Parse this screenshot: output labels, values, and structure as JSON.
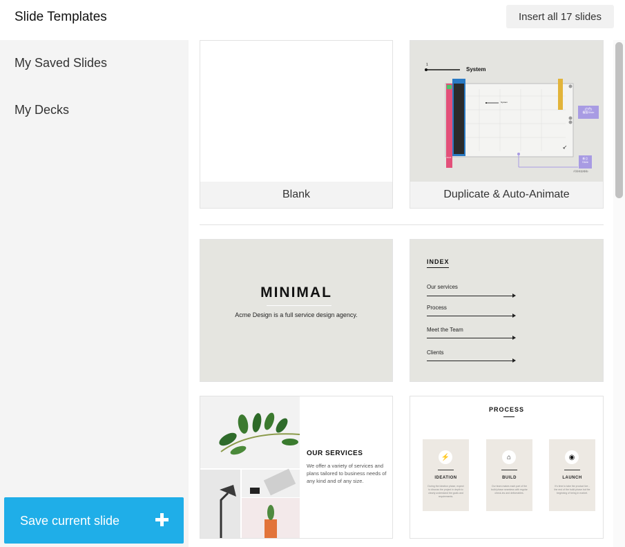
{
  "header": {
    "title": "Slide Templates",
    "insert_all_label": "Insert all 17 slides"
  },
  "sidebar": {
    "items": [
      {
        "label": "My Saved Slides"
      },
      {
        "label": "My Decks"
      }
    ],
    "save_label": "Save current slide",
    "save_icon": "plus-icon"
  },
  "templates": {
    "blank": {
      "caption": "Blank"
    },
    "duplicate": {
      "caption": "Duplicate & Auto-Animate",
      "system_label": "System",
      "small_system_label": "System",
      "badge1": "Dock",
      "badge_right1": "(白色)\n複製Slide",
      "badge_right2": "新立\nSlide",
      "note": "(可用/新加/移除)"
    },
    "minimal": {
      "title": "MINIMAL",
      "subtitle": "Acme Design is a full service design agency."
    },
    "index": {
      "title": "INDEX",
      "items": [
        "Our services",
        "Process",
        "Meet the Team",
        "Clients"
      ]
    },
    "services": {
      "title": "OUR SERVICES",
      "body": "We offer a variety of services and plans tailored to business needs of any kind and of any size."
    },
    "process": {
      "title": "PROCESS",
      "steps": [
        {
          "name": "IDEATION",
          "icon": "bolt-icon",
          "text": "During the ideation phase, expect to discuss the project in depth to clearly understand the goals and requirements."
        },
        {
          "name": "BUILD",
          "icon": "house-icon",
          "text": "Our team makes each part of the build phase seamless with regular check-ins and deliverables."
        },
        {
          "name": "LAUNCH",
          "icon": "globe-icon",
          "text": "It's time to take the product live - the end of the build phase but the beginning of being in market."
        }
      ]
    }
  },
  "colors": {
    "accent": "#1faee8",
    "sidebar_bg": "#f4f4f4",
    "slide_bg": "#e5e5e0"
  }
}
